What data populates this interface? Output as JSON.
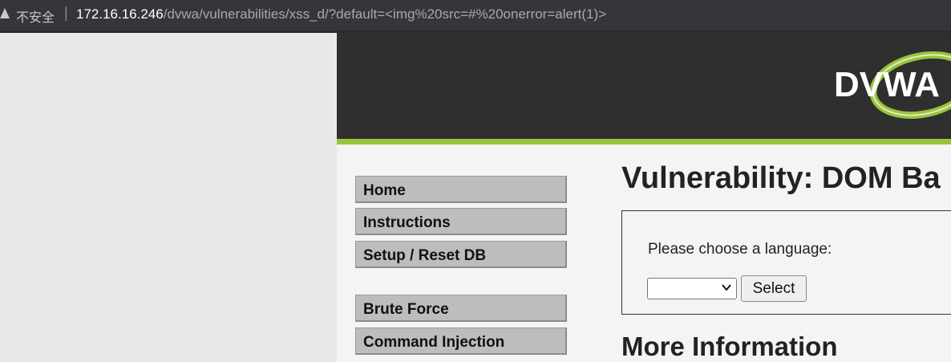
{
  "browser": {
    "security_label": "不安全",
    "separator": "|",
    "url_host": "172.16.16.246",
    "url_path": "/dvwa/vulnerabilities/xss_d/?default=<img%20src=#%20onerror=alert(1)>"
  },
  "header": {
    "logo_text": "DVWA"
  },
  "menu": {
    "items": [
      {
        "label": "Home"
      },
      {
        "label": "Instructions"
      },
      {
        "label": "Setup / Reset DB"
      },
      {
        "label": "Brute Force"
      },
      {
        "label": "Command Injection"
      }
    ]
  },
  "main": {
    "title": "Vulnerability: DOM Ba",
    "prompt": "Please choose a language:",
    "select_value": "",
    "select_button": "Select",
    "more_heading": "More Information"
  },
  "colors": {
    "header_bg": "#2f2f2f",
    "accent_green": "#98c43b",
    "menu_bg": "#bdbdbd"
  }
}
